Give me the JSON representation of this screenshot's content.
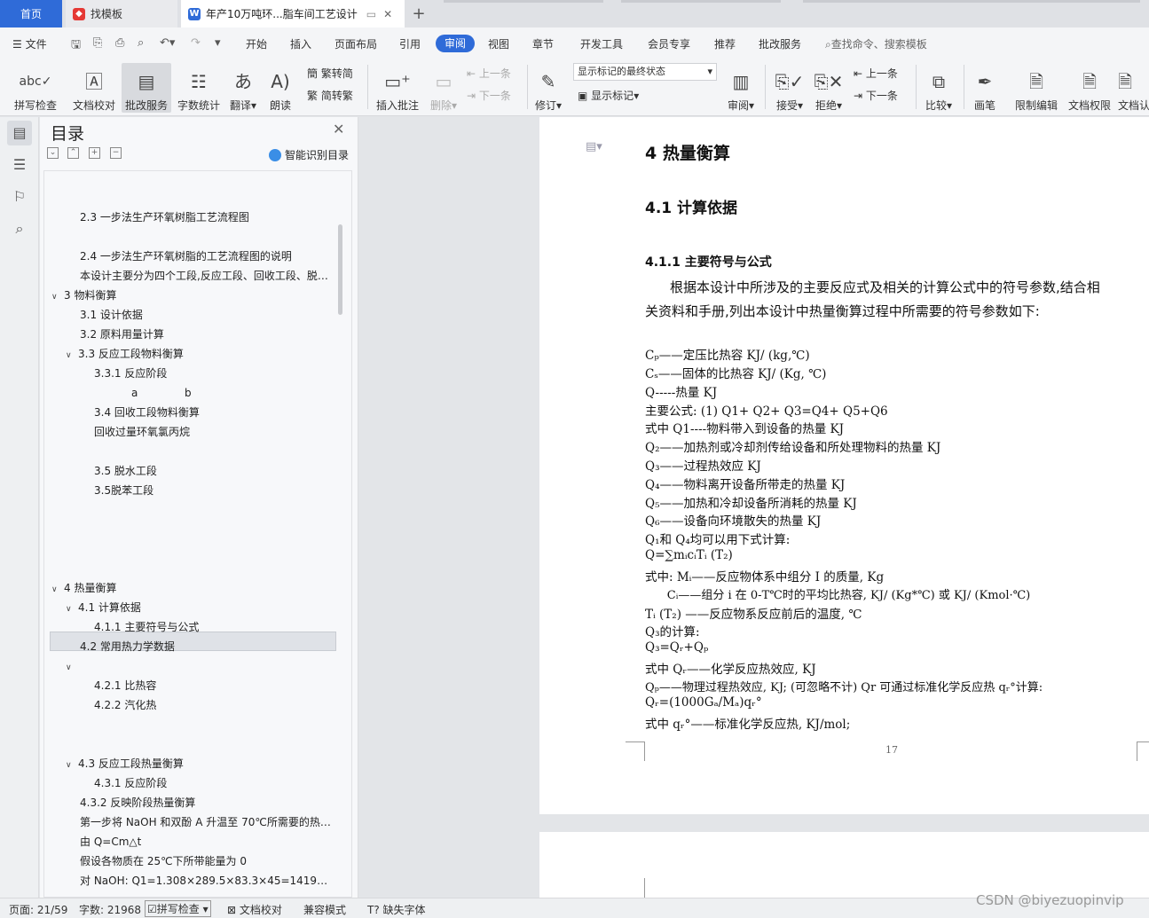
{
  "tabs": {
    "home": "首页",
    "templates": "找模板",
    "doc": "年产10万吨环...脂车间工艺设计",
    "add": "+"
  },
  "menu": {
    "file": "文件",
    "items": [
      "开始",
      "插入",
      "页面布局",
      "引用",
      "审阅",
      "视图",
      "章节",
      "开发工具",
      "会员专享",
      "推荐",
      "批改服务"
    ],
    "active": "审阅",
    "search": "查找命令、搜索模板"
  },
  "ribbon": {
    "spell": "拼写检查",
    "proof": "文档校对",
    "review_service": "批改服务",
    "wordcount": "字数统计",
    "translate": "翻译",
    "read": "朗读",
    "trad": "繁转简",
    "simp": "简转繁",
    "insert_comment": "插入批注",
    "delete": "删除",
    "prev_c": "上一条",
    "next_c": "下一条",
    "track": "修订",
    "markup_state": "显示标记的最终状态",
    "show_markup": "显示标记",
    "review": "审阅",
    "accept": "接受",
    "reject": "拒绝",
    "prev": "上一条",
    "next": "下一条",
    "compare": "比较",
    "pen": "画笔",
    "restrict": "限制编辑",
    "permission": "文档权限",
    "certify": "文档认"
  },
  "nav": {
    "title": "目录",
    "smart": "智能识别目录",
    "items": [
      "2.3  一步法生产环氧树脂工艺流程图",
      "2.4 一步法生产环氧树脂的工艺流程图的说明",
      "本设计主要分为四个工段,反应工段、回收工段、脱…",
      "3  物料衡算",
      "3.1  设计依据",
      "3.2  原料用量计算",
      "3.3  反应工段物料衡算",
      "3.3.1  反应阶段",
      "a",
      "b",
      "3.4 回收工段物料衡算",
      "回收过量环氧氯丙烷",
      "3.5  脱水工段",
      "3.5脱苯工段",
      "4    热量衡算",
      "4.1 计算依据",
      "4.1.1  主要符号与公式",
      "4.2  常用热力学数据",
      "",
      "4.2.1  比热容",
      "4.2.2  汽化热",
      "4.3  反应工段热量衡算",
      "4.3.1 反应阶段",
      "4.3.2 反映阶段热量衡算",
      "第一步将 NaOH 和双酚 A 升温至 70℃所需要的热…",
      "由 Q=Cm△t",
      "假设各物质在 25℃下所带能量为 0",
      "对 NaOH:  Q1=1.308×289.5×83.3×45=141985…"
    ]
  },
  "doc": {
    "h1": "4    热量衡算",
    "h2": "4.1 计算依据",
    "h3": "4.1.1  主要符号与公式",
    "para1": "根据本设计中所涉及的主要反应式及相关的计算公式中的符号参数,结合相",
    "para2": "关资料和手册,列出本设计中热量衡算过程中所需要的符号参数如下:",
    "lines": [
      "Cₚ——定压比热容 KJ/ (kg,℃)",
      "Cₛ——固体的比热容 KJ/ (Kg, ℃)",
      "Q-----热量 KJ",
      "主要公式: (1) Q1+ Q2+ Q3=Q4+ Q5+Q6",
      "式中 Q1----物料带入到设备的热量 KJ",
      "Q₂——加热剂或冷却剂传给设备和所处理物料的热量 KJ",
      "Q₃——过程热效应 KJ",
      "Q₄——物料离开设备所带走的热量 KJ",
      "Q₅——加热和冷却设备所消耗的热量 KJ",
      "Q₆——设备向环境散失的热量 KJ",
      "Q₁和 Q₄均可以用下式计算:",
      "Q=∑mᵢcᵢTᵢ (T₂)",
      "式中: Mᵢ——反应物体系中组分 I 的质量, Kg",
      "      Cᵢ——组分 i 在 0-T℃时的平均比热容, KJ/ (Kg*℃) 或 KJ/ (Kmol·℃)",
      "Tᵢ (T₂) ——反应物系反应前后的温度, ℃",
      "Q₃的计算:",
      "Q₃=Qᵣ+Qₚ",
      "式中 Qᵣ——化学反应热效应, KJ",
      "Qₚ——物理过程热效应, KJ; (可忽略不计) Qr 可通过标准化学反应热 qᵣ°计算:",
      "Qᵣ=(1000Gₐ/Mₐ)qᵣ°",
      "式中 qᵣ°——标准化学反应热, KJ/mol;"
    ],
    "page_number": "17"
  },
  "status": {
    "page": "页面: 21/59",
    "words": "字数: 21968",
    "spell": "拼写检查",
    "proof": "文档校对",
    "compat": "兼容模式",
    "font": "缺失字体"
  },
  "watermark": "CSDN @biyezuopinvip"
}
